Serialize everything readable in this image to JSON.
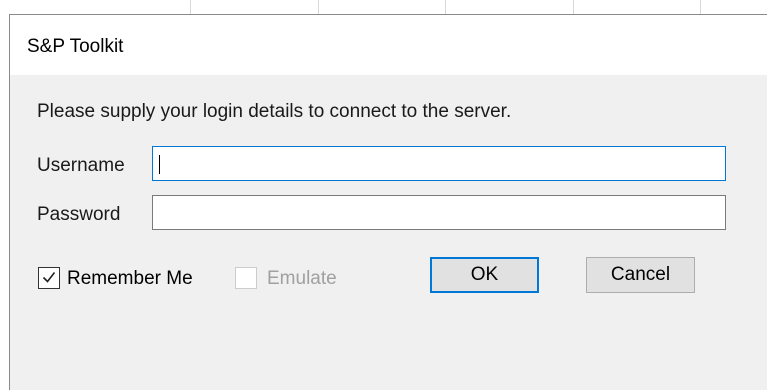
{
  "dialog": {
    "title": "S&P Toolkit",
    "instruction": "Please supply your login details to connect to the server."
  },
  "form": {
    "username_label": "Username",
    "username_value": "",
    "password_label": "Password",
    "password_value": ""
  },
  "options": {
    "remember_me_label": "Remember Me",
    "remember_me_checked": true,
    "emulate_label": "Emulate",
    "emulate_checked": false,
    "emulate_enabled": false
  },
  "buttons": {
    "ok_label": "OK",
    "cancel_label": "Cancel"
  },
  "colors": {
    "accent": "#0078d7",
    "dialog_background": "#f0f0f0"
  },
  "icons": {
    "remember_me_check": "checkmark-icon"
  }
}
